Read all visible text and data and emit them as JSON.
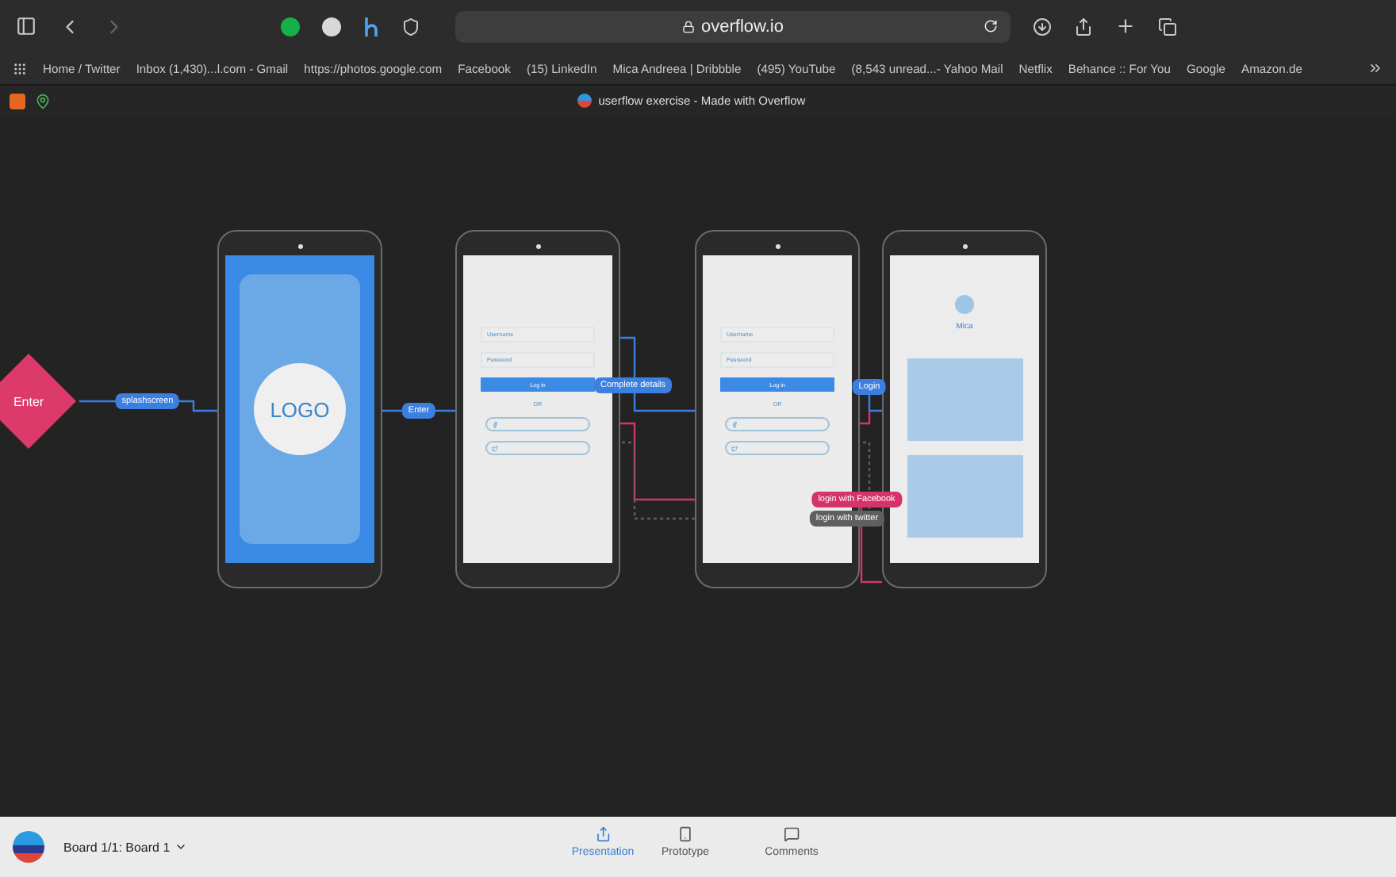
{
  "browser": {
    "url": "overflow.io",
    "bookmarks": [
      "Home / Twitter",
      "Inbox (1,430)...l.com - Gmail",
      "https://photos.google.com",
      "Facebook",
      "(15) LinkedIn",
      "Mica Andreea | Dribbble",
      "(495) YouTube",
      "(8,543 unread...- Yahoo Mail",
      "Netflix",
      "Behance :: For You",
      "Google",
      "Amazon.de"
    ],
    "tab_title": "userflow exercise - Made with Overflow"
  },
  "flow": {
    "start": {
      "label": "Enter"
    },
    "screens": [
      {
        "kind": "splash",
        "logo": "LOGO"
      },
      {
        "kind": "login",
        "fields": [
          "Username",
          "Password"
        ],
        "button": "Log in",
        "divider": "OR"
      },
      {
        "kind": "login",
        "fields": [
          "Username",
          "Password"
        ],
        "button": "Log in",
        "divider": "OR"
      },
      {
        "kind": "account",
        "name": "Mica"
      }
    ],
    "connectors": [
      {
        "label": "splashscreen",
        "color": "#3b7fe0"
      },
      {
        "label": "Enter",
        "color": "#3b7fe0"
      },
      {
        "label": "Complete details",
        "color": "#3b7fe0"
      },
      {
        "label": "Login",
        "color": "#3b7fe0"
      },
      {
        "label": "login with Facebook",
        "color": "#d6336c"
      },
      {
        "label": "login with twitter",
        "color": "#5f5f5f"
      }
    ]
  },
  "bottom_bar": {
    "board": "Board 1/1: Board 1",
    "tabs": [
      {
        "label": "Presentation",
        "selected": true
      },
      {
        "label": "Prototype",
        "selected": false
      },
      {
        "label": "Comments",
        "selected": false
      }
    ]
  }
}
